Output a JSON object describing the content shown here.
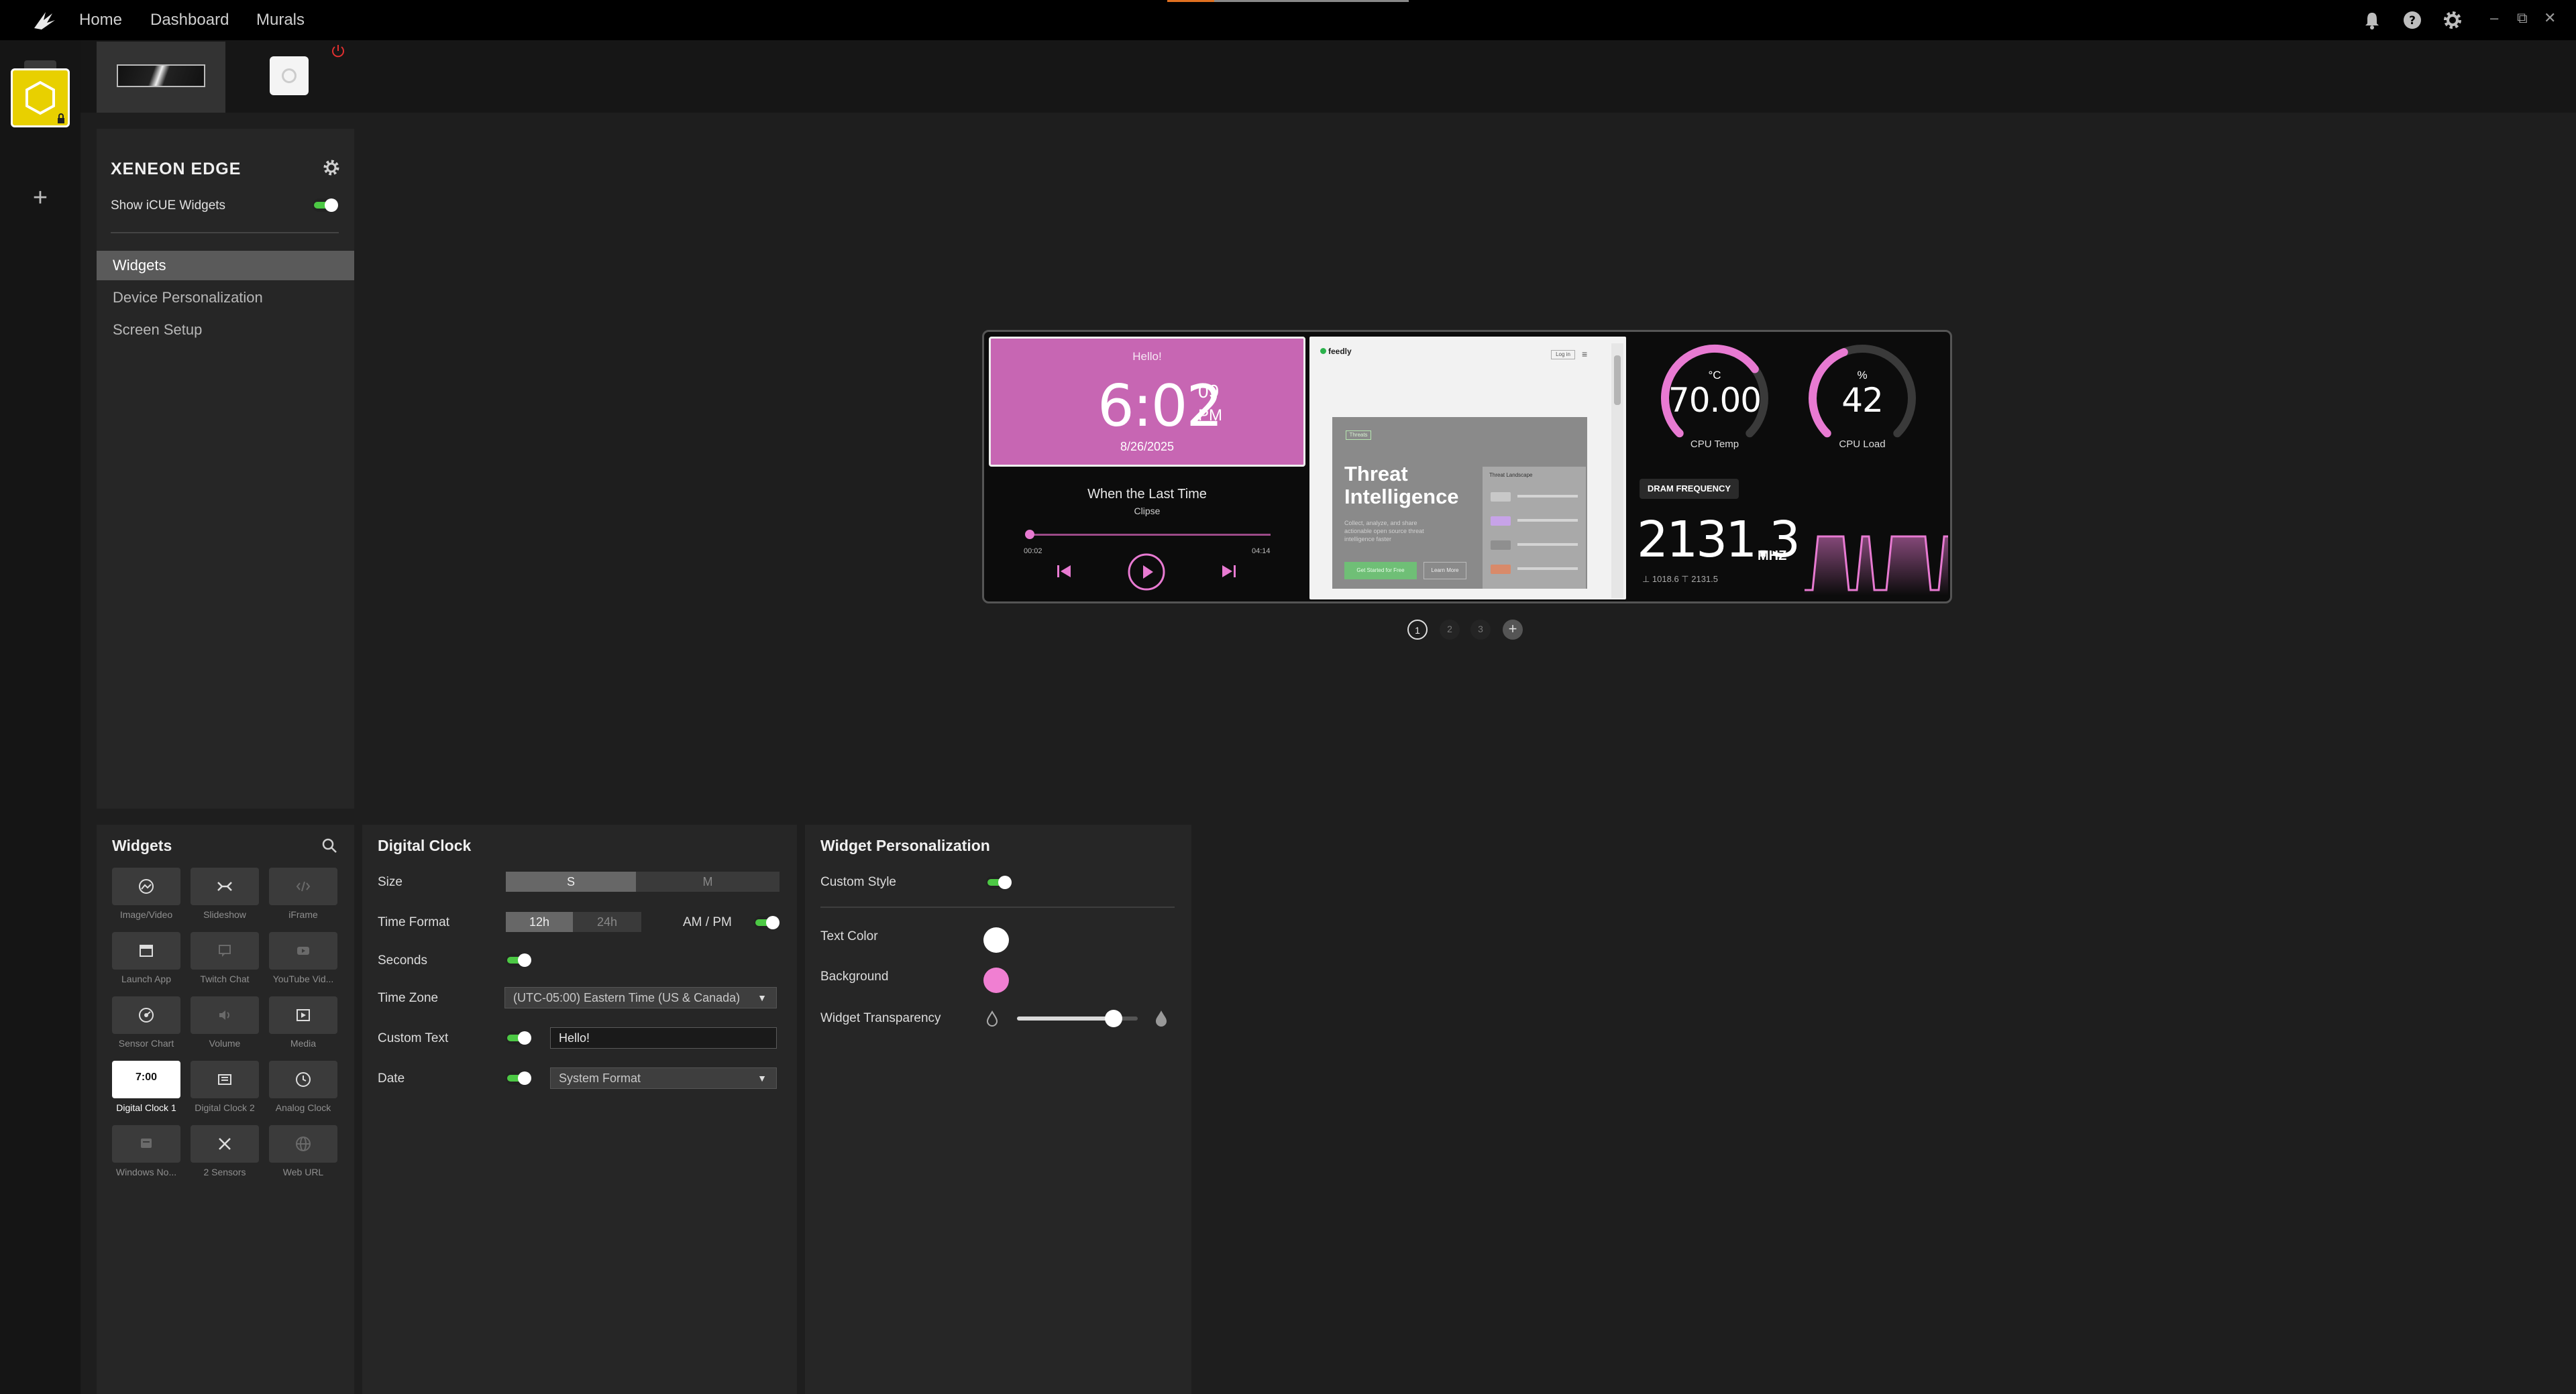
{
  "nav": {
    "home": "Home",
    "dashboard": "Dashboard",
    "murals": "Murals"
  },
  "device": {
    "title": "XENEON EDGE",
    "show_widgets_label": "Show iCUE Widgets",
    "show_widgets_on": true,
    "menu": [
      "Widgets",
      "Device Personalization",
      "Screen Setup"
    ],
    "active_menu": "Widgets"
  },
  "preview": {
    "clock": {
      "greeting": "Hello!",
      "time": "6:02",
      "seconds": "09",
      "ampm": "PM",
      "date": "8/26/2025",
      "background": "#c766b3"
    },
    "media": {
      "title": "When the Last Time",
      "artist": "Clipse",
      "elapsed": "00:02",
      "duration": "04:14",
      "progress": 0.01
    },
    "iframe": {
      "brand": "feedly",
      "login": "Log in",
      "tag": "Threats",
      "headline": "Threat Intelligence",
      "subtext": "Collect, analyze, and share actionable open source threat intelligence faster",
      "cta_primary": "Get Started for Free",
      "cta_secondary": "Learn More",
      "panel_title": "Threat Landscape"
    },
    "cpu_temp": {
      "unit": "°C",
      "value": "70.00",
      "label": "CPU Temp",
      "fraction": 0.7
    },
    "cpu_load": {
      "unit": "%",
      "value": "42",
      "label": "CPU Load",
      "fraction": 0.42
    },
    "dram": {
      "chip": "DRAM FREQUENCY",
      "value": "2131.3",
      "unit": "MHZ",
      "stats": "⊥ 1018.6  ⊤ 2131.5"
    }
  },
  "pager": {
    "pages": [
      "1",
      "2",
      "3"
    ],
    "active": "1",
    "add": "+"
  },
  "widgets_panel": {
    "title": "Widgets",
    "items": [
      {
        "label": "Image/Video",
        "icon": "image-icon"
      },
      {
        "label": "Slideshow",
        "icon": "slideshow-icon"
      },
      {
        "label": "iFrame",
        "icon": "code-icon"
      },
      {
        "label": "Launch App",
        "icon": "app-window-icon"
      },
      {
        "label": "Twitch Chat",
        "icon": "chat-icon"
      },
      {
        "label": "YouTube Vid...",
        "icon": "youtube-icon"
      },
      {
        "label": "Sensor Chart",
        "icon": "sensor-icon"
      },
      {
        "label": "Volume",
        "icon": "speaker-icon"
      },
      {
        "label": "Media",
        "icon": "media-icon"
      },
      {
        "label": "Digital Clock 1",
        "icon": "digital-clock-icon",
        "tile_text": "7:00",
        "selected": true
      },
      {
        "label": "Digital Clock 2",
        "icon": "digital-clock-2-icon"
      },
      {
        "label": "Analog Clock",
        "icon": "analog-clock-icon"
      },
      {
        "label": "Windows No...",
        "icon": "notification-icon"
      },
      {
        "label": "2 Sensors",
        "icon": "two-sensors-icon"
      },
      {
        "label": "Web URL",
        "icon": "globe-icon"
      }
    ]
  },
  "clock_settings": {
    "title": "Digital Clock",
    "size_label": "Size",
    "size_options": [
      "S",
      "M"
    ],
    "size_selected": "S",
    "time_format_label": "Time Format",
    "time_format_options": [
      "12h",
      "24h"
    ],
    "time_format_selected": "12h",
    "ampm_label": "AM / PM",
    "ampm_on": true,
    "seconds_label": "Seconds",
    "seconds_on": true,
    "timezone_label": "Time Zone",
    "timezone_value": "(UTC-05:00) Eastern Time (US & Canada)",
    "custom_text_label": "Custom Text",
    "custom_text_on": true,
    "custom_text_value": "Hello!",
    "date_label": "Date",
    "date_on": true,
    "date_format_value": "System Format"
  },
  "personalization": {
    "title": "Widget Personalization",
    "custom_style_label": "Custom Style",
    "custom_style_on": true,
    "text_color_label": "Text Color",
    "text_color": "#ffffff",
    "background_label": "Background",
    "background_color": "#f07fd2",
    "transparency_label": "Widget Transparency",
    "transparency": 0.8
  },
  "colors": {
    "accent_green": "#4cc844",
    "accent_pink": "#e87ad2",
    "device_yellow": "#e8d000"
  }
}
